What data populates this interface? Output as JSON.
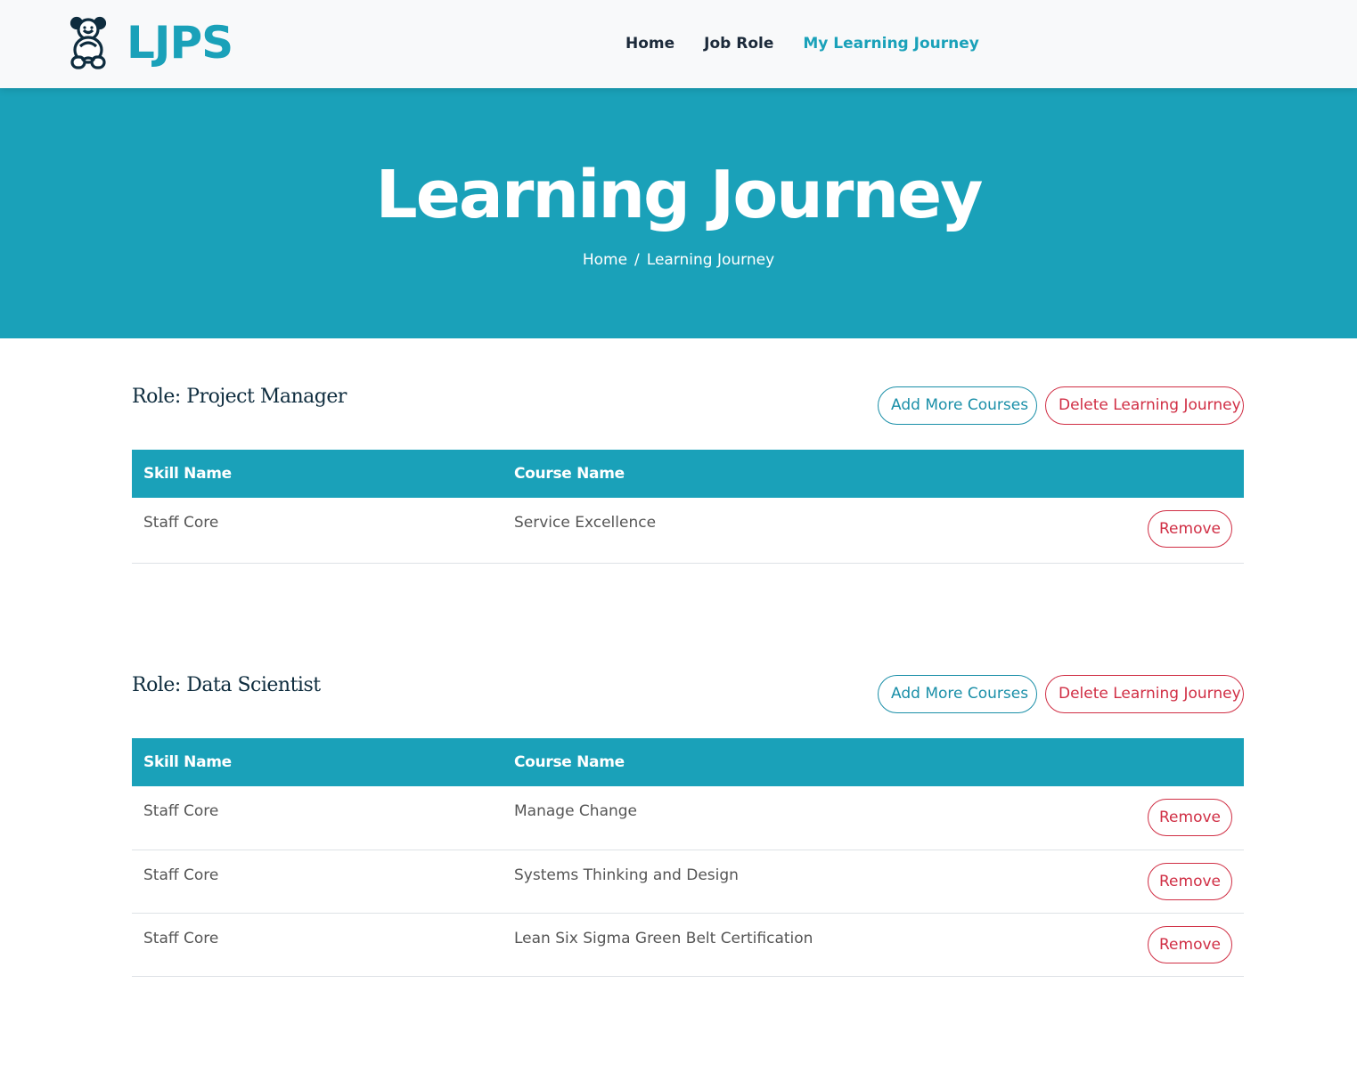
{
  "brand": {
    "name": "LJPS",
    "logo_icon": "teddy-bear-icon"
  },
  "nav": {
    "items": [
      "Home",
      "Job Role",
      "My Learning Journey"
    ],
    "active": "My Learning Journey"
  },
  "hero": {
    "title": "Learning Journey",
    "breadcrumb": {
      "home": "Home",
      "separator": "/",
      "current": "Learning Journey"
    }
  },
  "labels": {
    "add_more_courses": "Add More Courses",
    "delete_learning_journey": "Delete Learning Journey",
    "skill_name_header": "Skill Name",
    "course_name_header": "Course Name",
    "remove": "Remove"
  },
  "journeys": [
    {
      "role": "Role: Project Manager",
      "rows": [
        {
          "skill": "Staff Core",
          "course": "Service Excellence"
        }
      ]
    },
    {
      "role": "Role: Data Scientist",
      "rows": [
        {
          "skill": "Staff Core",
          "course": "Manage Change"
        },
        {
          "skill": "Staff Core",
          "course": "Systems Thinking and Design"
        },
        {
          "skill": "Staff Core",
          "course": "Lean Six Sigma Green Belt Certification"
        }
      ]
    }
  ],
  "colors": {
    "primary": "#1aa1b9",
    "danger": "#d02e44",
    "navy": "#0e2c3e"
  }
}
